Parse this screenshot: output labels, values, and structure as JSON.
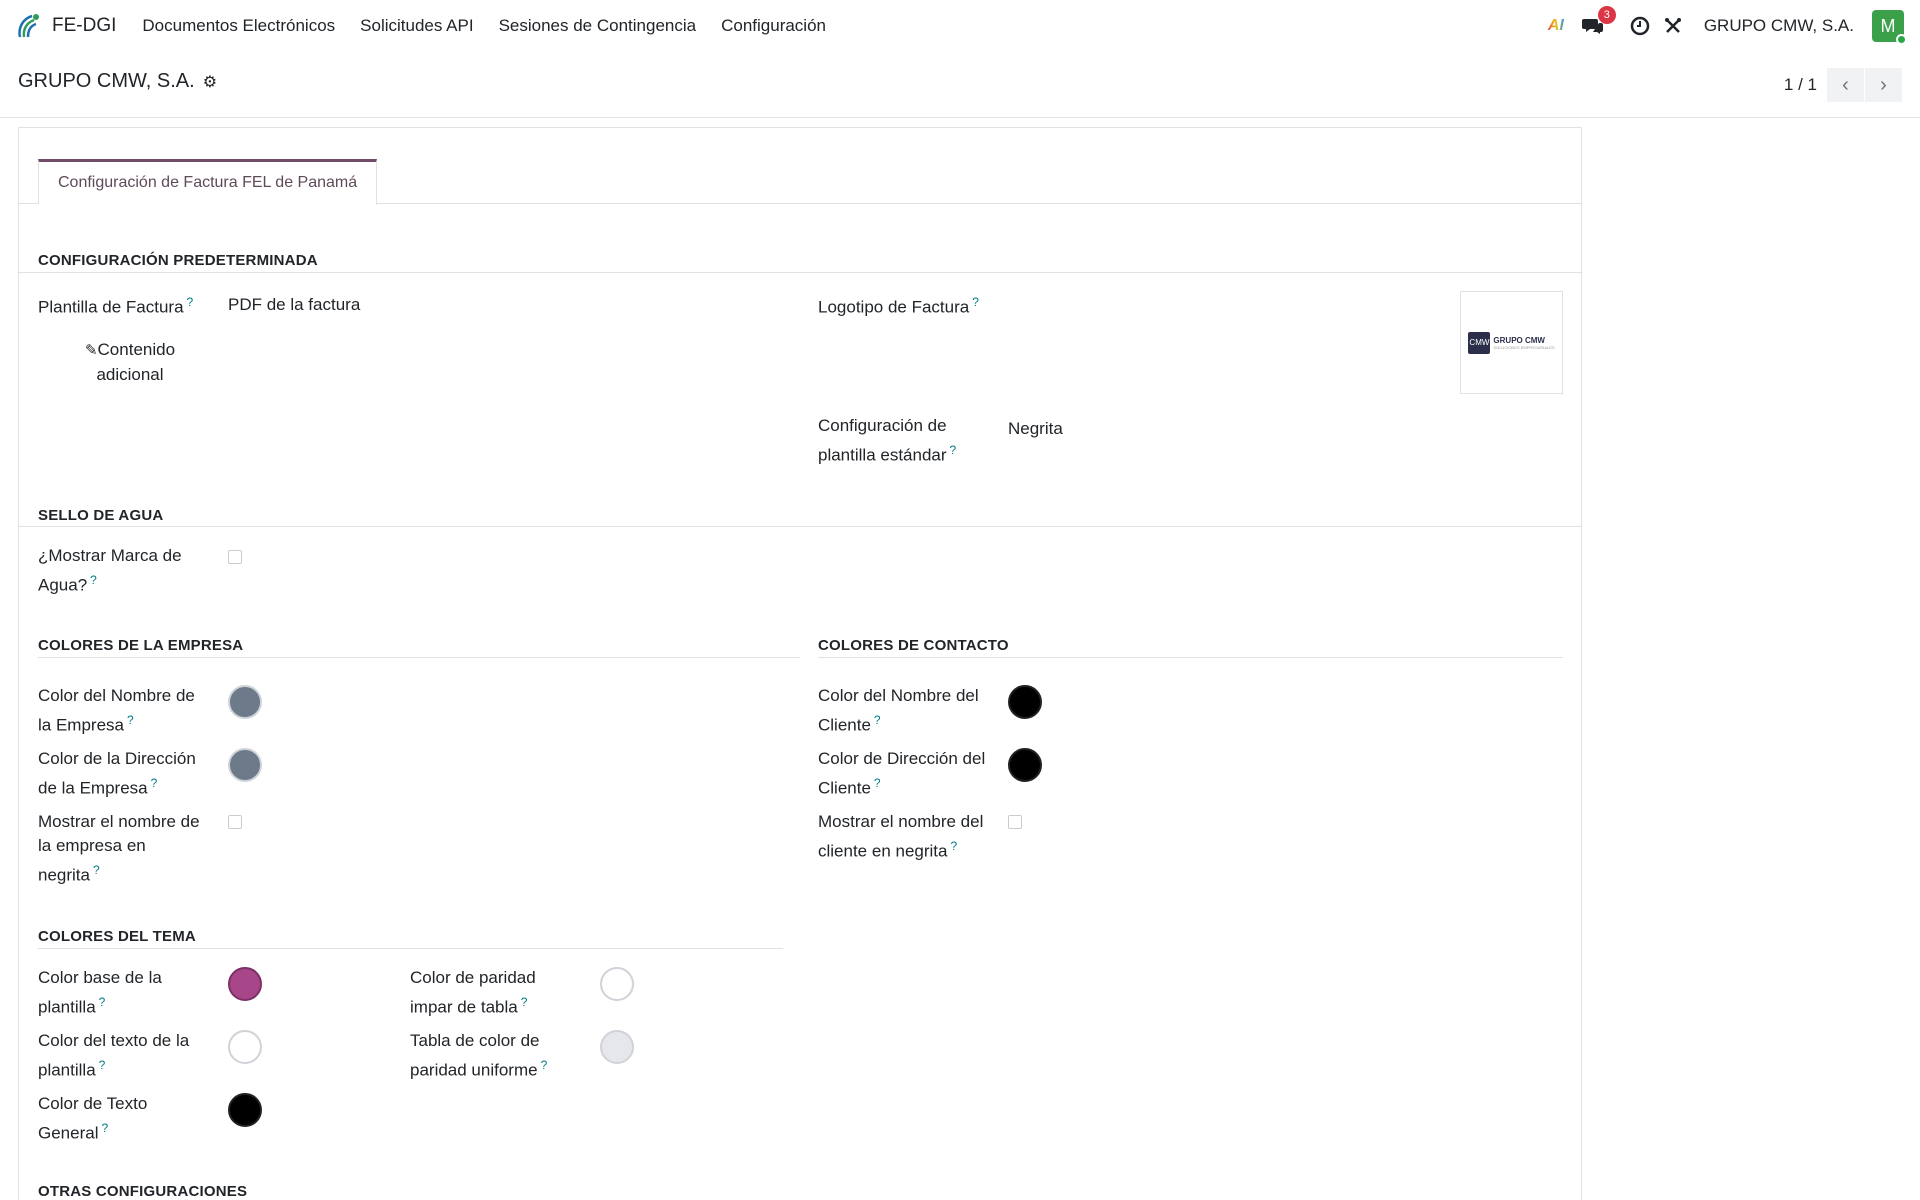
{
  "navbar": {
    "app_name": "FE-DGI",
    "menu": [
      "Documentos Electrónicos",
      "Solicitudes API",
      "Sesiones de Contingencia",
      "Configuración"
    ],
    "messages_badge": "3",
    "company": "GRUPO CMW, S.A.",
    "avatar_letter": "M"
  },
  "control_panel": {
    "title": "GRUPO CMW, S.A.",
    "pager_value": "1 / 1"
  },
  "tab": {
    "label": "Configuración de Factura FEL de Panamá"
  },
  "sections": {
    "default_config": "CONFIGURACIÓN PREDETERMINADA",
    "watermark": "SELLO DE AGUA",
    "company_colors": "COLORES DE LA EMPRESA",
    "contact_colors": "COLORES DE CONTACTO",
    "theme_colors": "COLORES DEL TEMA",
    "other": "OTRAS CONFIGURACIONES"
  },
  "fields": {
    "invoice_template": {
      "label": "Plantilla de Factura",
      "value": "PDF de la factura"
    },
    "additional_content": {
      "line1": "Contenido",
      "line2": "adicional"
    },
    "invoice_logo": {
      "label": "Logotipo de Factura",
      "logo_mark": "CMW",
      "logo_text": "GRUPO CMW",
      "logo_sub": "SOLUCIONES EMPRESARIALES"
    },
    "standard_template": {
      "line1": "Configuración de",
      "line2": "plantilla estándar",
      "value": "Negrita"
    },
    "show_watermark": {
      "line1": "¿Mostrar Marca de",
      "line2": "Agua?",
      "checked": false
    },
    "company_name_color": {
      "line1": "Color del Nombre de",
      "line2": "la Empresa",
      "color": "#6c7a89"
    },
    "company_address_color": {
      "line1": "Color de la Dirección",
      "line2": "de la Empresa",
      "color": "#6c7a89"
    },
    "company_name_bold": {
      "line1": "Mostrar el nombre de",
      "line2": "la empresa en",
      "line3": "negrita",
      "checked": false
    },
    "client_name_color": {
      "line1": "Color del Nombre del",
      "line2": "Cliente",
      "color": "#000000"
    },
    "client_address_color": {
      "line1": "Color de Dirección del",
      "line2": "Cliente",
      "color": "#000000"
    },
    "client_name_bold": {
      "line1": "Mostrar el nombre del",
      "line2": "cliente en negrita",
      "checked": false
    },
    "template_base_color": {
      "line1": "Color base de la",
      "line2": "plantilla",
      "color": "#a8468a"
    },
    "template_text_color": {
      "line1": "Color del texto de la",
      "line2": "plantilla",
      "color": "#ffffff"
    },
    "general_text_color": {
      "line1": "Color de Texto",
      "line2": "General",
      "color": "#000000"
    },
    "odd_table_color": {
      "line1": "Color de paridad",
      "line2": "impar de tabla",
      "color": "#ffffff"
    },
    "even_table_color": {
      "line1": "Tabla de color de",
      "line2": "paridad uniforme",
      "color": "#e5e7ea"
    }
  }
}
